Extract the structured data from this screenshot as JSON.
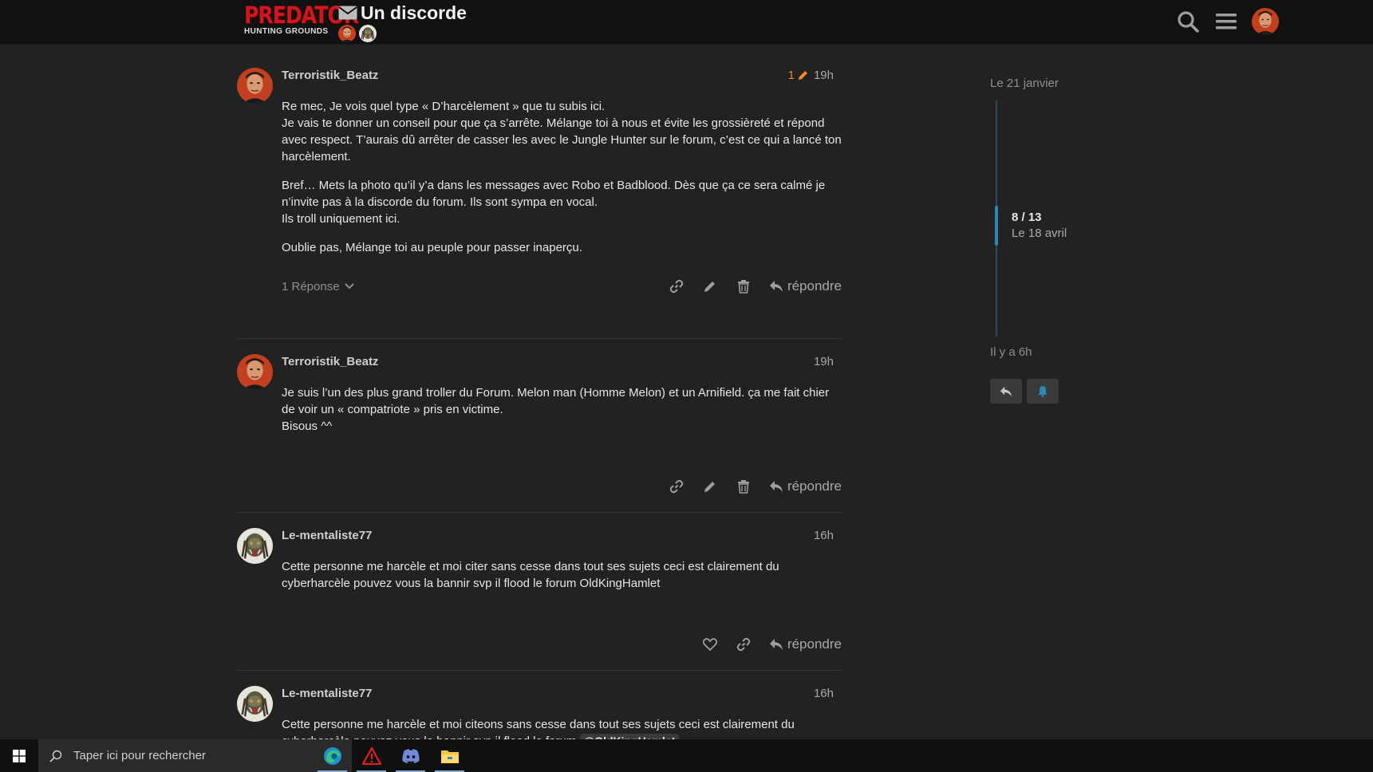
{
  "header": {
    "logo_main": "PREDATOR",
    "logo_sub": "HUNTING GROUNDS",
    "topic_title": "Un discorde",
    "icons": [
      "envelope-icon",
      "search-icon",
      "hamburger-menu-icon"
    ]
  },
  "posts": [
    {
      "username": "Terroristik_Beatz",
      "edit_count": "1",
      "time": "19h",
      "paragraphs": [
        "Re mec, Je vois quel type « D’harcèlement » que tu subis ici.\nJe vais te donner un conseil pour que ça s’arrête. Mélange toi à nous et évite les grossièreté et répond avec respect. T’aurais dû arrêter de casser les avec le Jungle Hunter sur le forum, c’est ce qui a lancé ton harcèlement.",
        "Bref… Mets la photo qu’il y’a dans les messages avec Robo et Badblood. Dès que ça ce sera calmé je n’invite pas à la discorde du forum. Ils sont sympa en vocal.\nIls troll uniquement ici.",
        "Oublie pas, Mélange toi au peuple pour passer inaperçu."
      ],
      "replies_label": "1 Réponse",
      "reply_label": "répondre"
    },
    {
      "username": "Terroristik_Beatz",
      "time": "19h",
      "paragraphs": [
        "Je suis l’un des plus grand troller du Forum. Melon man (Homme Melon) et un Arnifield. ça me fait chier de voir un « compatriote » pris en victime.\nBisous ^^"
      ],
      "reply_label": "répondre"
    },
    {
      "username": "Le-mentaliste77",
      "time": "16h",
      "paragraphs": [
        "Cette personne me harcèle et moi citer sans cesse dans tout ses sujets ceci est clairement du cyberharcèle pouvez vous la bannir svp il flood le forum OldKingHamlet"
      ],
      "reply_label": "répondre"
    },
    {
      "username": "Le-mentaliste77",
      "time": "16h",
      "text_before_mention": "Cette personne me harcèle et moi citeons sans cesse dans tout ses sujets ceci est clairement du cyberharcèle pouvez vous la bannir svp il flood le forum ",
      "mention": "@OldKingHamlet"
    }
  ],
  "timeline": {
    "start_date": "Le 21 janvier",
    "position": "8 / 13",
    "position_date": "Le 18 avril",
    "end_label": "Il y a 6h",
    "accent": "#2e86b6"
  },
  "taskbar": {
    "search_placeholder": "Taper ici pour rechercher",
    "apps": [
      "edge-icon",
      "app-warning-icon",
      "discord-icon",
      "file-explorer-icon"
    ]
  },
  "colors": {
    "background": "#222222",
    "header": "#111111",
    "logo_red": "#d2161d",
    "edit_orange": "#f68a1f",
    "bell_blue": "#2e86b6"
  }
}
